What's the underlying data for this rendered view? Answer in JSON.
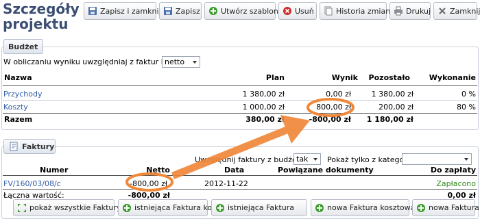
{
  "page": {
    "title": "Szczegóły projektu"
  },
  "toolbar": {
    "save_close": "Zapisz i zamknij",
    "save": "Zapisz",
    "create_template": "Utwórz szablon",
    "delete": "Usuń",
    "history": "Historia zmian",
    "print": "Drukuj",
    "close": "Zamknij"
  },
  "budget": {
    "legend": "Budżet",
    "filter_label": "W obliczaniu wyniku uwzględniaj z faktur kwoty:",
    "filter_value": "netto",
    "columns": {
      "name": "Nazwa",
      "plan": "Plan",
      "result": "Wynik",
      "remaining": "Pozostało",
      "execution": "Wykonanie"
    },
    "rows": [
      {
        "name": "Przychody",
        "plan": "1 380,00 zł",
        "result": "0,00 zł",
        "remaining": "1 380,00 zł",
        "execution": "0 %"
      },
      {
        "name": "Koszty",
        "plan": "1 000,00 zł",
        "result": "800,00 zł",
        "remaining": "200,00 zł",
        "execution": "80 %"
      }
    ],
    "total": {
      "name": "Razem",
      "plan": "380,00 zł",
      "result": "-800,00 zł",
      "remaining": "1 180,00 zł"
    }
  },
  "invoices": {
    "legend": "Faktury",
    "include_label": "Uwzględnij faktury z budżetu",
    "include_value": "tak",
    "category_label": "Pokaż tylko z kategorii:",
    "category_value": "",
    "columns": {
      "number": "Numer",
      "net": "Netto",
      "date": "Data",
      "related": "Powiązane dokumenty",
      "to_pay": "Do zapłaty"
    },
    "rows": [
      {
        "number": "FV/160/03/08/c",
        "net": "-800,00 zł",
        "date": "2012-11-22",
        "related": "",
        "to_pay": "Zapłacono"
      }
    ],
    "total_label": "Łączna wartość:",
    "total_net": "-800,00 zł",
    "total_to_pay": "0,00 zł"
  },
  "buttons": {
    "show_all": "pokaż wszystkie Faktury",
    "existing_cost": "istniejąca Faktura kosztowa",
    "existing": "istniejąca Faktura",
    "new_cost": "nowa Faktura kosztowa",
    "new": "nowa Faktura"
  },
  "colors": {
    "annotation": "#f0883a",
    "title": "#3b4e72",
    "link": "#2f5da8",
    "paid": "#2c8a17"
  }
}
